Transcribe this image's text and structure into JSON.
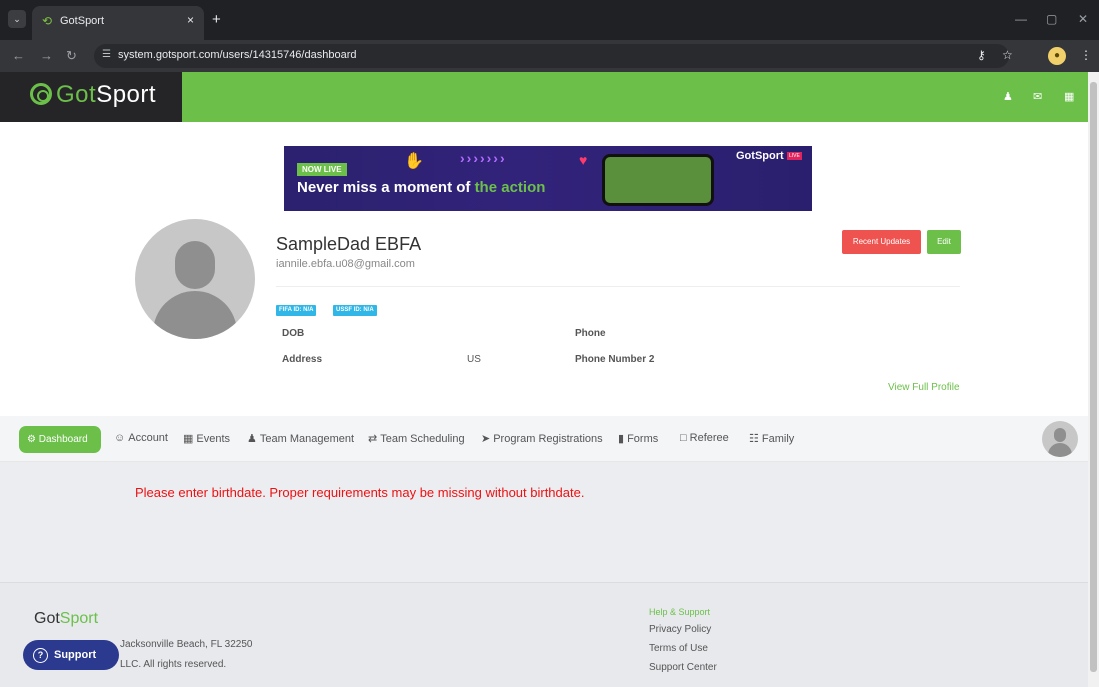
{
  "browser": {
    "tab_title": "GotSport",
    "tab_close": "×",
    "new_tab": "+",
    "url": "system.gotsport.com/users/14315746/dashboard"
  },
  "header": {
    "logo_prefix": "Got",
    "logo_suffix": "Sport",
    "icons": [
      "user-icon",
      "mail-icon",
      "apps-icon"
    ]
  },
  "banner": {
    "badge": "NOW LIVE",
    "text_prefix": "Never miss a moment of ",
    "text_highlight": "the action",
    "brand": "GotSport",
    "live_tag": "LIVE"
  },
  "profile": {
    "name": "SampleDad EBFA",
    "email": "iannile.ebfa.u08@gmail.com",
    "recent_updates_label": "Recent Updates",
    "edit_label": "Edit",
    "fifa_badge": "FIFA ID: N/A",
    "ussf_badge": "USSF ID: N/A",
    "dob_label": "DOB",
    "address_label": "Address",
    "address_value": "US",
    "phone_label": "Phone",
    "phone2_label": "Phone Number 2",
    "view_full_profile": "View Full Profile"
  },
  "nav": {
    "dashboard": "Dashboard",
    "account": "Account",
    "events": "Events",
    "team_management": "Team Management",
    "team_scheduling": "Team Scheduling",
    "program_registrations": "Program Registrations",
    "forms": "Forms",
    "referee": "Referee",
    "family": "Family"
  },
  "main": {
    "warning": "Please enter birthdate. Proper requirements may be missing without birthdate."
  },
  "footer": {
    "logo_prefix": "Got",
    "logo_suffix": "Sport",
    "address": "Jacksonville Beach, FL 32250",
    "rights": "LLC. All rights reserved.",
    "help_heading": "Help & Support",
    "privacy": "Privacy Policy",
    "terms": "Terms of Use",
    "support_center": "Support Center",
    "support_button": "Support"
  },
  "colors": {
    "brand_green": "#6cc04a",
    "danger_red": "#ef5350",
    "info_blue": "#30b6e7"
  }
}
